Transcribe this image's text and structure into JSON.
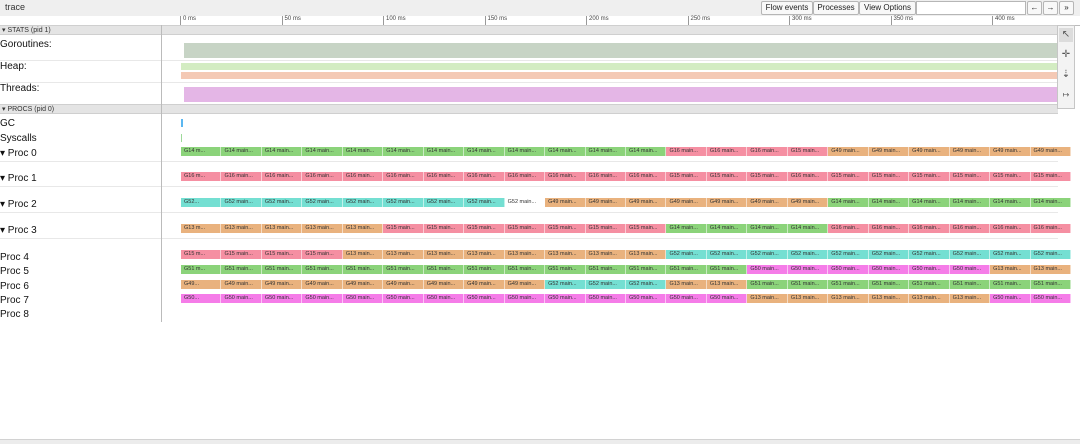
{
  "app": {
    "title": "trace"
  },
  "toolbar": {
    "flow_events": "Flow events",
    "processes": "Processes",
    "view_options": "View Options",
    "nav_back": "←",
    "nav_forward": "→",
    "nav_more": "»"
  },
  "ruler": {
    "ticks": [
      "0 ms",
      "50 ms",
      "100 ms",
      "150 ms",
      "200 ms",
      "250 ms",
      "300 ms",
      "350 ms",
      "400 ms"
    ]
  },
  "stats": {
    "header": "▾ STATS (pid 1)",
    "rows": [
      {
        "label": "Goroutines:",
        "colors": [
          "#c7d4c5"
        ]
      },
      {
        "label": "Heap:",
        "colors": [
          "#d3ecc2",
          "#f4c9b5"
        ]
      },
      {
        "label": "Threads:",
        "colors": [
          "#e4b6e6"
        ]
      }
    ]
  },
  "procs": {
    "header": "▾ PROCS (pid 0)",
    "gc_label": "GC",
    "syscalls_label": "Syscalls",
    "rows": [
      {
        "label": "▾ Proc 0",
        "slices": [
          {
            "text": "G14 m...",
            "color": "#8bd37a"
          },
          {
            "text": "G14 main...",
            "color": "#8bd37a"
          },
          {
            "text": "G14 main...",
            "color": "#8bd37a"
          },
          {
            "text": "G14 main...",
            "color": "#8bd37a"
          },
          {
            "text": "G14 main...",
            "color": "#8bd37a"
          },
          {
            "text": "G14 main...",
            "color": "#8bd37a"
          },
          {
            "text": "G14 main...",
            "color": "#8bd37a"
          },
          {
            "text": "G14 main...",
            "color": "#8bd37a"
          },
          {
            "text": "G14 main...",
            "color": "#8bd37a"
          },
          {
            "text": "G14 main...",
            "color": "#8bd37a"
          },
          {
            "text": "G14 main...",
            "color": "#8bd37a"
          },
          {
            "text": "G14 main...",
            "color": "#8bd37a"
          },
          {
            "text": "G16 main...",
            "color": "#f58fa2"
          },
          {
            "text": "G16 main...",
            "color": "#f58fa2"
          },
          {
            "text": "G16 main...",
            "color": "#f58fa2"
          },
          {
            "text": "G15 main...",
            "color": "#f58fa2"
          },
          {
            "text": "G49 main...",
            "color": "#e9b27e"
          },
          {
            "text": "G49 main...",
            "color": "#e9b27e"
          },
          {
            "text": "G49 main...",
            "color": "#e9b27e"
          },
          {
            "text": "G49 main...",
            "color": "#e9b27e"
          },
          {
            "text": "G49 main...",
            "color": "#e9b27e"
          },
          {
            "text": "G49 main...",
            "color": "#e9b27e"
          }
        ]
      },
      {
        "label": "▾ Proc 1",
        "slices": [
          {
            "text": "G16 m...",
            "color": "#f58fa2"
          },
          {
            "text": "G16 main...",
            "color": "#f58fa2"
          },
          {
            "text": "G16 main...",
            "color": "#f58fa2"
          },
          {
            "text": "G16 main...",
            "color": "#f58fa2"
          },
          {
            "text": "G16 main...",
            "color": "#f58fa2"
          },
          {
            "text": "G16 main...",
            "color": "#f58fa2"
          },
          {
            "text": "G16 main...",
            "color": "#f58fa2"
          },
          {
            "text": "G16 main...",
            "color": "#f58fa2"
          },
          {
            "text": "G16 main...",
            "color": "#f58fa2"
          },
          {
            "text": "G16 main...",
            "color": "#f58fa2"
          },
          {
            "text": "G16 main...",
            "color": "#f58fa2"
          },
          {
            "text": "G16 main...",
            "color": "#f58fa2"
          },
          {
            "text": "G15 main...",
            "color": "#f58fa2"
          },
          {
            "text": "G15 main...",
            "color": "#f58fa2"
          },
          {
            "text": "G15 main...",
            "color": "#f58fa2"
          },
          {
            "text": "G16 main...",
            "color": "#f58fa2"
          },
          {
            "text": "G15 main...",
            "color": "#f58fa2"
          },
          {
            "text": "G15 main...",
            "color": "#f58fa2"
          },
          {
            "text": "G15 main...",
            "color": "#f58fa2"
          },
          {
            "text": "G15 main...",
            "color": "#f58fa2"
          },
          {
            "text": "G15 main...",
            "color": "#f58fa2"
          },
          {
            "text": "G15 main...",
            "color": "#f58fa2"
          }
        ]
      },
      {
        "label": "▾ Proc 2",
        "slices": [
          {
            "text": "G52...",
            "color": "#74dfd2"
          },
          {
            "text": "G52 main...",
            "color": "#74dfd2"
          },
          {
            "text": "G52 main...",
            "color": "#74dfd2"
          },
          {
            "text": "G52 main...",
            "color": "#74dfd2"
          },
          {
            "text": "G52 main...",
            "color": "#74dfd2"
          },
          {
            "text": "G52 main...",
            "color": "#74dfd2"
          },
          {
            "text": "G52 main...",
            "color": "#74dfd2"
          },
          {
            "text": "G52 main...",
            "color": "#74dfd2"
          },
          {
            "text": "G52 main...",
            "color": "#ffffff"
          },
          {
            "text": "G49 main...",
            "color": "#e9b27e"
          },
          {
            "text": "G49 main...",
            "color": "#e9b27e"
          },
          {
            "text": "G49 main...",
            "color": "#e9b27e"
          },
          {
            "text": "G49 main...",
            "color": "#e9b27e"
          },
          {
            "text": "G49 main...",
            "color": "#e9b27e"
          },
          {
            "text": "G49 main...",
            "color": "#e9b27e"
          },
          {
            "text": "G49 main...",
            "color": "#e9b27e"
          },
          {
            "text": "G14 main...",
            "color": "#8bd37a"
          },
          {
            "text": "G14 main...",
            "color": "#8bd37a"
          },
          {
            "text": "G14 main...",
            "color": "#8bd37a"
          },
          {
            "text": "G14 main...",
            "color": "#8bd37a"
          },
          {
            "text": "G14 main...",
            "color": "#8bd37a"
          },
          {
            "text": "G14 main...",
            "color": "#8bd37a"
          }
        ]
      },
      {
        "label": "▾ Proc 3",
        "slices": [
          {
            "text": "G13 m...",
            "color": "#e9b27e"
          },
          {
            "text": "G13 main...",
            "color": "#e9b27e"
          },
          {
            "text": "G13 main...",
            "color": "#e9b27e"
          },
          {
            "text": "G13 main...",
            "color": "#e9b27e"
          },
          {
            "text": "G13 main...",
            "color": "#e9b27e"
          },
          {
            "text": "G15 main...",
            "color": "#f58fa2"
          },
          {
            "text": "G15 main...",
            "color": "#f58fa2"
          },
          {
            "text": "G15 main...",
            "color": "#f58fa2"
          },
          {
            "text": "G15 main...",
            "color": "#f58fa2"
          },
          {
            "text": "G15 main...",
            "color": "#f58fa2"
          },
          {
            "text": "G15 main...",
            "color": "#f58fa2"
          },
          {
            "text": "G15 main...",
            "color": "#f58fa2"
          },
          {
            "text": "G14 main...",
            "color": "#8bd37a"
          },
          {
            "text": "G14 main...",
            "color": "#8bd37a"
          },
          {
            "text": "G14 main...",
            "color": "#8bd37a"
          },
          {
            "text": "G14 main...",
            "color": "#8bd37a"
          },
          {
            "text": "G16 main...",
            "color": "#f58fa2"
          },
          {
            "text": "G16 main...",
            "color": "#f58fa2"
          },
          {
            "text": "G16 main...",
            "color": "#f58fa2"
          },
          {
            "text": "G16 main...",
            "color": "#f58fa2"
          },
          {
            "text": "G16 main...",
            "color": "#f58fa2"
          },
          {
            "text": "G16 main...",
            "color": "#f58fa2"
          }
        ]
      },
      {
        "label": "Proc 4",
        "slices": [
          {
            "text": "G15 m...",
            "color": "#f58fa2"
          },
          {
            "text": "G15 main...",
            "color": "#f58fa2"
          },
          {
            "text": "G15 main...",
            "color": "#f58fa2"
          },
          {
            "text": "G15 main...",
            "color": "#f58fa2"
          },
          {
            "text": "G13 main...",
            "color": "#e9b27e"
          },
          {
            "text": "G13 main...",
            "color": "#e9b27e"
          },
          {
            "text": "G13 main...",
            "color": "#e9b27e"
          },
          {
            "text": "G13 main...",
            "color": "#e9b27e"
          },
          {
            "text": "G13 main...",
            "color": "#e9b27e"
          },
          {
            "text": "G13 main...",
            "color": "#e9b27e"
          },
          {
            "text": "G13 main...",
            "color": "#e9b27e"
          },
          {
            "text": "G13 main...",
            "color": "#e9b27e"
          },
          {
            "text": "G52 main...",
            "color": "#74dfd2"
          },
          {
            "text": "G52 main...",
            "color": "#74dfd2"
          },
          {
            "text": "G52 main...",
            "color": "#74dfd2"
          },
          {
            "text": "G52 main...",
            "color": "#74dfd2"
          },
          {
            "text": "G52 main...",
            "color": "#74dfd2"
          },
          {
            "text": "G52 main...",
            "color": "#74dfd2"
          },
          {
            "text": "G52 main...",
            "color": "#74dfd2"
          },
          {
            "text": "G52 main...",
            "color": "#74dfd2"
          },
          {
            "text": "G52 main...",
            "color": "#74dfd2"
          },
          {
            "text": "G52 main...",
            "color": "#74dfd2"
          }
        ]
      },
      {
        "label": "Proc 5",
        "slices": [
          {
            "text": "G51 m...",
            "color": "#8bd37a"
          },
          {
            "text": "G51 main...",
            "color": "#8bd37a"
          },
          {
            "text": "G51 main...",
            "color": "#8bd37a"
          },
          {
            "text": "G51 main...",
            "color": "#8bd37a"
          },
          {
            "text": "G51 main...",
            "color": "#8bd37a"
          },
          {
            "text": "G51 main...",
            "color": "#8bd37a"
          },
          {
            "text": "G51 main...",
            "color": "#8bd37a"
          },
          {
            "text": "G51 main...",
            "color": "#8bd37a"
          },
          {
            "text": "G51 main...",
            "color": "#8bd37a"
          },
          {
            "text": "G51 main...",
            "color": "#8bd37a"
          },
          {
            "text": "G51 main...",
            "color": "#8bd37a"
          },
          {
            "text": "G51 main...",
            "color": "#8bd37a"
          },
          {
            "text": "G51 main...",
            "color": "#8bd37a"
          },
          {
            "text": "G51 main...",
            "color": "#8bd37a"
          },
          {
            "text": "G50 main...",
            "color": "#f57ce8"
          },
          {
            "text": "G50 main...",
            "color": "#f57ce8"
          },
          {
            "text": "G50 main...",
            "color": "#f57ce8"
          },
          {
            "text": "G50 main...",
            "color": "#f57ce8"
          },
          {
            "text": "G50 main...",
            "color": "#f57ce8"
          },
          {
            "text": "G50 main...",
            "color": "#f57ce8"
          },
          {
            "text": "G13 main...",
            "color": "#e9b27e"
          },
          {
            "text": "G13 main...",
            "color": "#e9b27e"
          }
        ]
      },
      {
        "label": "Proc 6",
        "slices": [
          {
            "text": "G49...",
            "color": "#e9b27e"
          },
          {
            "text": "G49 main...",
            "color": "#e9b27e"
          },
          {
            "text": "G49 main...",
            "color": "#e9b27e"
          },
          {
            "text": "G49 main...",
            "color": "#e9b27e"
          },
          {
            "text": "G49 main...",
            "color": "#e9b27e"
          },
          {
            "text": "G49 main...",
            "color": "#e9b27e"
          },
          {
            "text": "G49 main...",
            "color": "#e9b27e"
          },
          {
            "text": "G49 main...",
            "color": "#e9b27e"
          },
          {
            "text": "G49 main...",
            "color": "#e9b27e"
          },
          {
            "text": "G52 main...",
            "color": "#74dfd2"
          },
          {
            "text": "G52 main...",
            "color": "#74dfd2"
          },
          {
            "text": "G52 main...",
            "color": "#74dfd2"
          },
          {
            "text": "G13 main...",
            "color": "#e9b27e"
          },
          {
            "text": "G13 main...",
            "color": "#e9b27e"
          },
          {
            "text": "G51 main...",
            "color": "#8bd37a"
          },
          {
            "text": "G51 main...",
            "color": "#8bd37a"
          },
          {
            "text": "G51 main...",
            "color": "#8bd37a"
          },
          {
            "text": "G51 main...",
            "color": "#8bd37a"
          },
          {
            "text": "G51 main...",
            "color": "#8bd37a"
          },
          {
            "text": "G51 main...",
            "color": "#8bd37a"
          },
          {
            "text": "G51 main...",
            "color": "#8bd37a"
          },
          {
            "text": "G51 main...",
            "color": "#8bd37a"
          }
        ]
      },
      {
        "label": "Proc 7",
        "slices": [
          {
            "text": "G50...",
            "color": "#f57ce8"
          },
          {
            "text": "G50 main...",
            "color": "#f57ce8"
          },
          {
            "text": "G50 main...",
            "color": "#f57ce8"
          },
          {
            "text": "G50 main...",
            "color": "#f57ce8"
          },
          {
            "text": "G50 main...",
            "color": "#f57ce8"
          },
          {
            "text": "G50 main...",
            "color": "#f57ce8"
          },
          {
            "text": "G50 main...",
            "color": "#f57ce8"
          },
          {
            "text": "G50 main...",
            "color": "#f57ce8"
          },
          {
            "text": "G50 main...",
            "color": "#f57ce8"
          },
          {
            "text": "G50 main...",
            "color": "#f57ce8"
          },
          {
            "text": "G50 main...",
            "color": "#f57ce8"
          },
          {
            "text": "G50 main...",
            "color": "#f57ce8"
          },
          {
            "text": "G50 main...",
            "color": "#f57ce8"
          },
          {
            "text": "G50 main...",
            "color": "#f57ce8"
          },
          {
            "text": "G13 main...",
            "color": "#e9b27e"
          },
          {
            "text": "G13 main...",
            "color": "#e9b27e"
          },
          {
            "text": "G13 main...",
            "color": "#e9b27e"
          },
          {
            "text": "G13 main...",
            "color": "#e9b27e"
          },
          {
            "text": "G13 main...",
            "color": "#e9b27e"
          },
          {
            "text": "G13 main...",
            "color": "#e9b27e"
          },
          {
            "text": "G50 main...",
            "color": "#f57ce8"
          },
          {
            "text": "G50 main...",
            "color": "#f57ce8"
          }
        ]
      },
      {
        "label": "Proc 8",
        "slices": []
      }
    ]
  },
  "tools": [
    "select-arrow-icon",
    "pan-cross-icon",
    "zoom-arrow-icon",
    "timing-icon"
  ]
}
